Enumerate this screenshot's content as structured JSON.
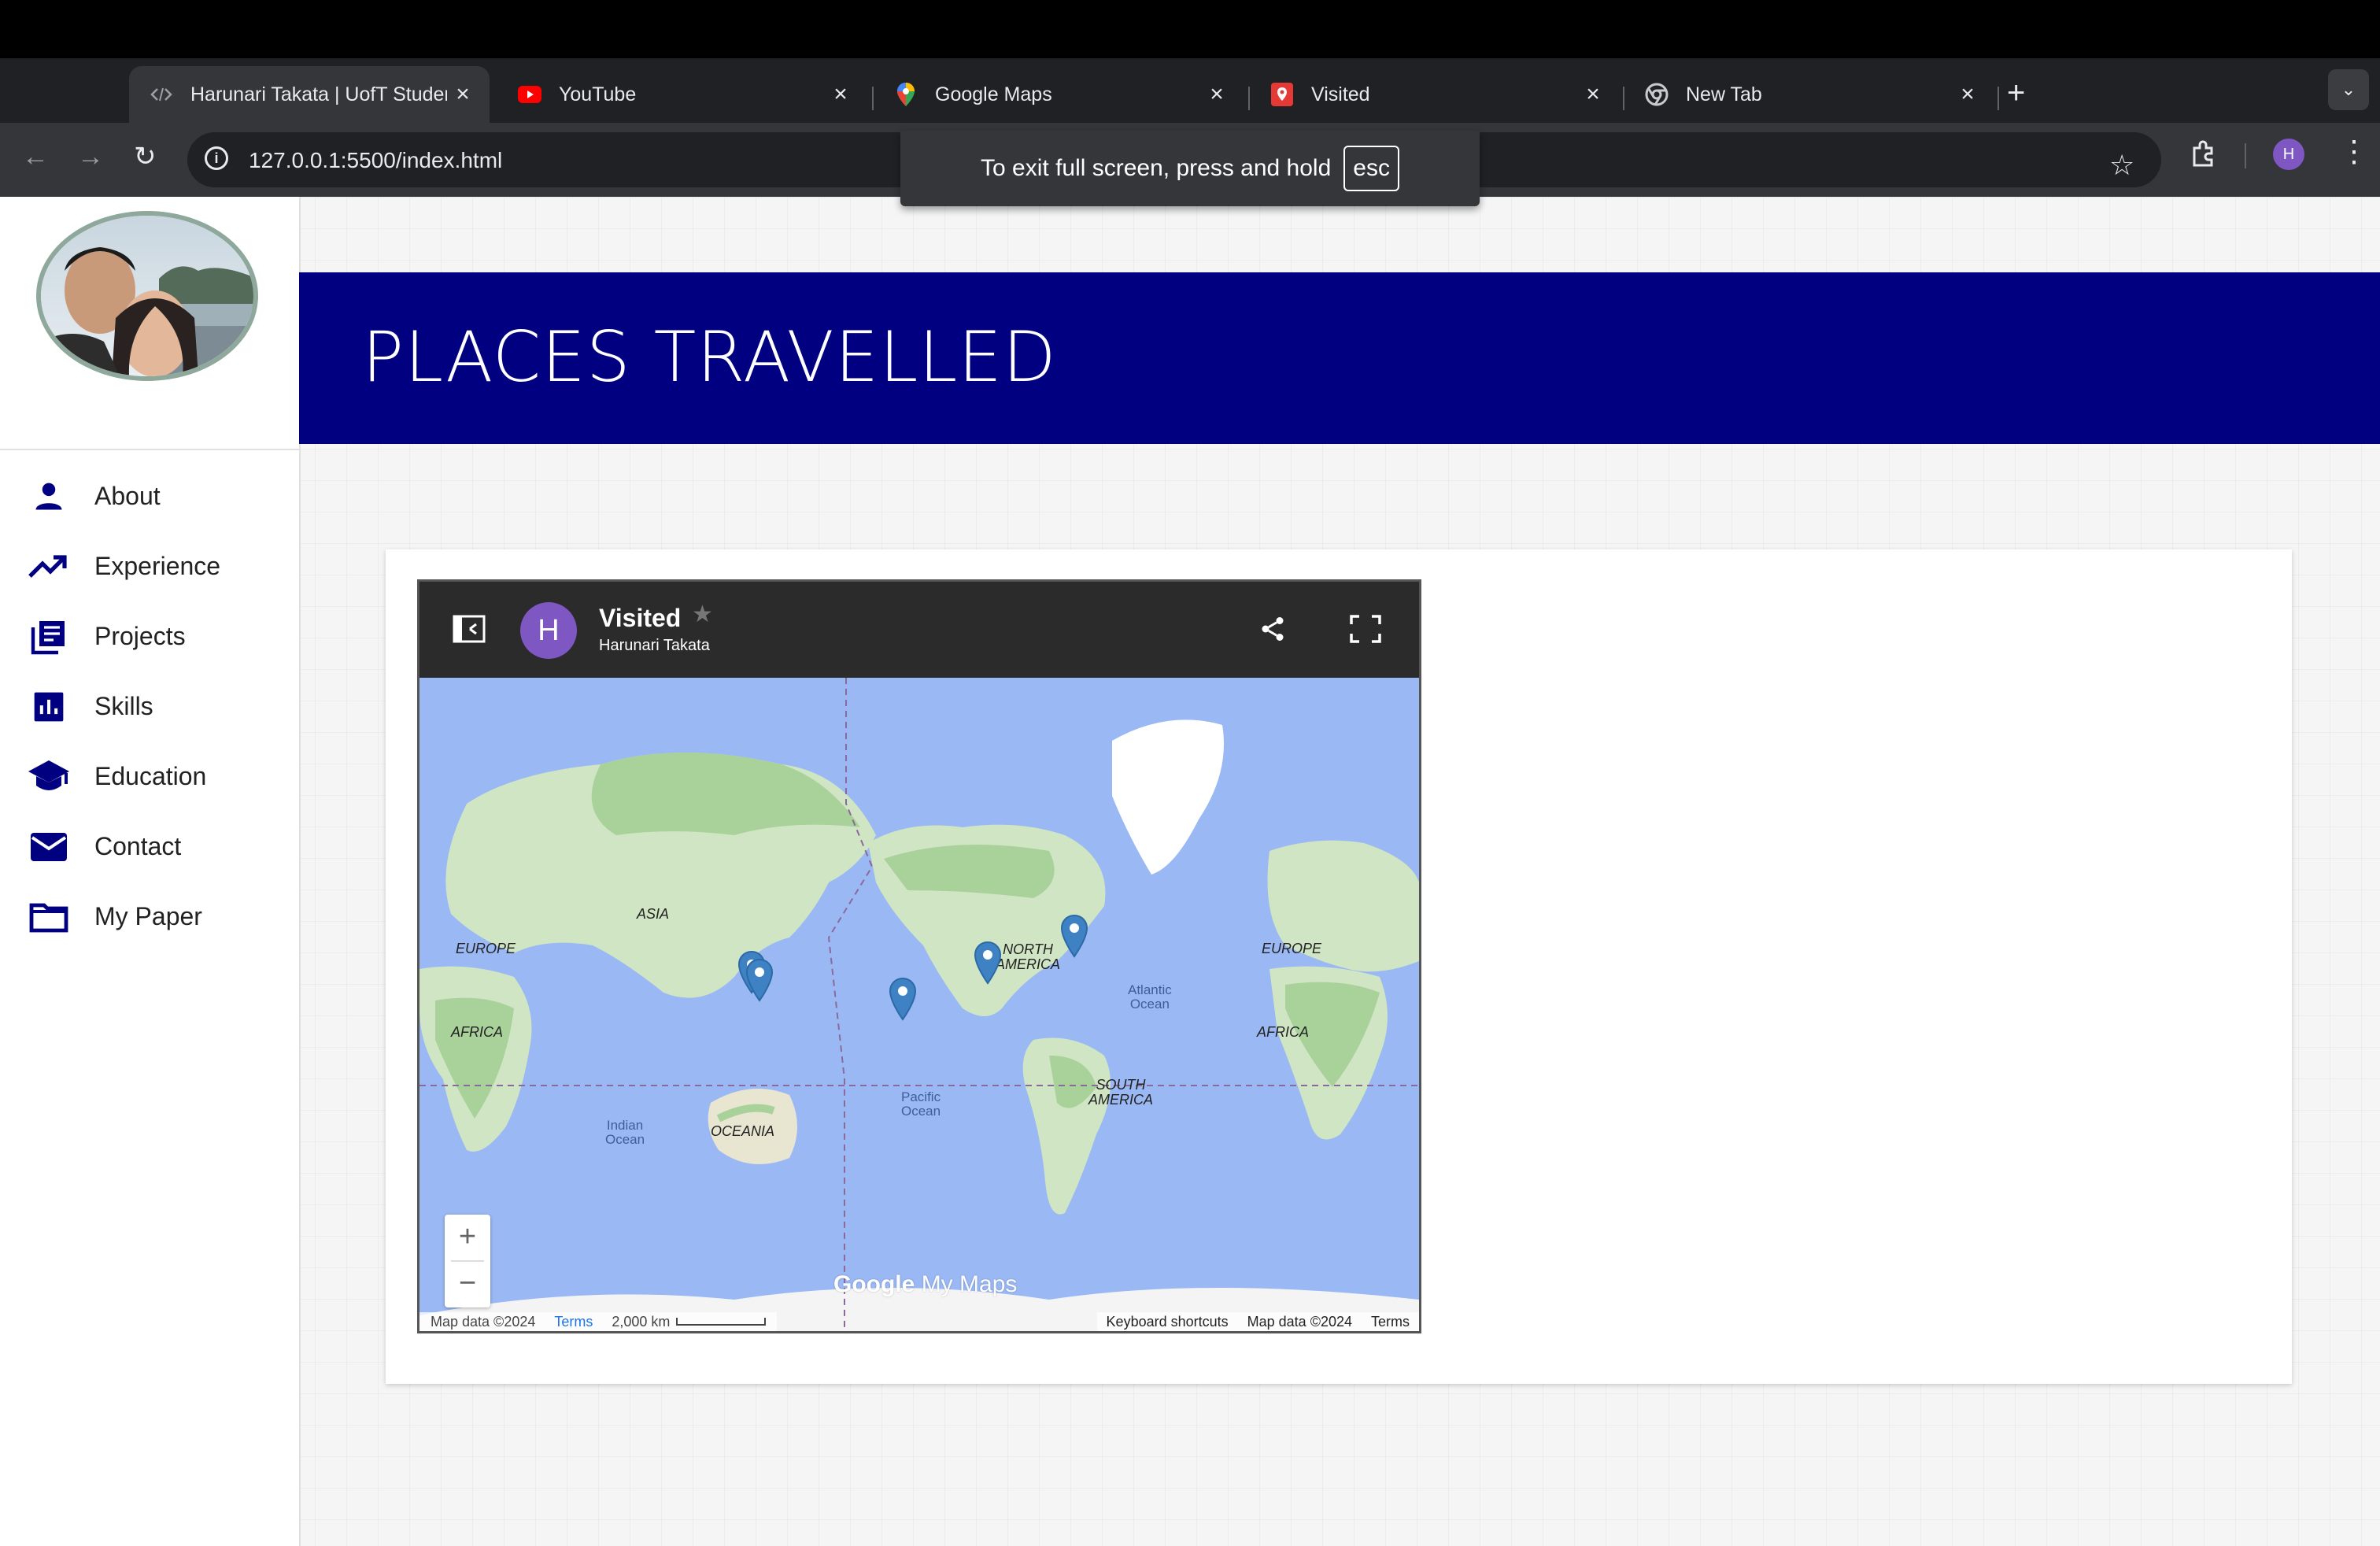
{
  "browser": {
    "tabs": [
      {
        "title": "Harunari Takata | UofT Student",
        "icon": "code-icon",
        "active": true
      },
      {
        "title": "YouTube",
        "icon": "youtube-icon",
        "active": false
      },
      {
        "title": "Google Maps",
        "icon": "maps-pin-icon",
        "active": false
      },
      {
        "title": "Visited",
        "icon": "my-maps-icon",
        "active": false
      },
      {
        "title": "New Tab",
        "icon": "chrome-icon",
        "active": false
      }
    ],
    "url": "127.0.0.1:5500/index.html",
    "profile_initial": "H"
  },
  "fullscreen_toast": {
    "text": "To exit full screen, press and hold",
    "key": "esc"
  },
  "sidebar": {
    "items": [
      {
        "label": "About",
        "icon": "person-icon"
      },
      {
        "label": "Experience",
        "icon": "trending-up-icon"
      },
      {
        "label": "Projects",
        "icon": "library-books-icon"
      },
      {
        "label": "Skills",
        "icon": "bar-chart-icon"
      },
      {
        "label": "Education",
        "icon": "school-icon"
      },
      {
        "label": "Contact",
        "icon": "mail-icon"
      },
      {
        "label": "My Paper",
        "icon": "folder-icon"
      }
    ]
  },
  "header": {
    "title": "PLACES TRAVELLED"
  },
  "map_embed": {
    "avatar_initial": "H",
    "title": "Visited",
    "owner": "Harunari Takata",
    "labels": {
      "europe_left": "EUROPE",
      "asia": "ASIA",
      "africa_left": "AFRICA",
      "indian_1": "Indian",
      "indian_2": "Ocean",
      "oceania": "OCEANIA",
      "pacific_1": "Pacific",
      "pacific_2": "Ocean",
      "north_america_1": "NORTH",
      "north_america_2": "AMERICA",
      "atlantic_1": "Atlantic",
      "atlantic_2": "Ocean",
      "south_america_1": "SOUTH",
      "south_america_2": "AMERICA",
      "europe_right": "EUROPE",
      "africa_right": "AFRICA"
    },
    "zoom_in": "+",
    "zoom_out": "−",
    "branding": {
      "google": "Google",
      "suffix": "My Maps"
    },
    "attribution_left": {
      "data": "Map data ©2024",
      "terms": "Terms",
      "scale": "2,000 km"
    },
    "attribution_right": {
      "shortcuts": "Keyboard shortcuts",
      "data": "Map data ©2024",
      "terms": "Terms"
    },
    "pin_color": "#3f82c4"
  }
}
